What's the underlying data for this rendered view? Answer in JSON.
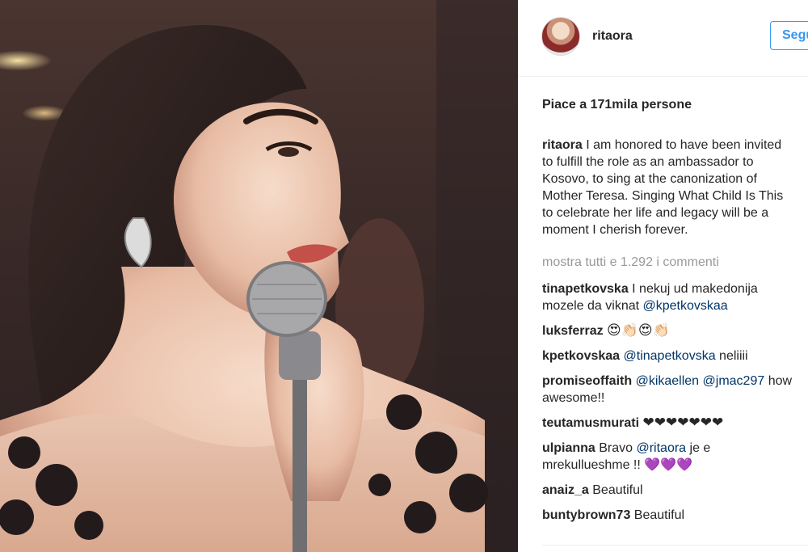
{
  "post": {
    "username": "ritaora",
    "follow_label": "Segui",
    "likes_text": "Piace a 171mila persone",
    "caption_user": "ritaora",
    "caption_text": " I am honored to have been invited\nto fulfill the role as an ambassador to\nKosovo, to sing at the canonization of\nMother Teresa. Singing What Child Is This\nto celebrate her life and legacy will be a\nmoment I cherish forever.",
    "show_all_comments": "mostra tutti e 1.292 i commenti"
  },
  "comments": [
    {
      "user": "tinapetkovska",
      "pre": " I nekuj ud makedonija\nmozele da viknat ",
      "mention": "@kpetkovskaa",
      "post": ""
    },
    {
      "user": "luksferraz",
      "pre": " ",
      "mention": "",
      "post": "😍👏🏻😍👏🏻"
    },
    {
      "user": "kpetkovskaa",
      "pre": " ",
      "mention": "@tinapetkovska",
      "post": " neliiii"
    },
    {
      "user": "promiseoffaith",
      "pre": " ",
      "mention": "@kikaellen @jmac297",
      "post": " how\nawesome!!"
    },
    {
      "user": "teutamusmurati",
      "pre": " ",
      "mention": "",
      "post": "❤❤❤❤❤❤❤"
    },
    {
      "user": "ulpianna",
      "pre": " Bravo ",
      "mention": "@ritaora",
      "post": " je e\nmrekullueshme !! 💜💜💜"
    },
    {
      "user": "anaiz_a",
      "pre": " Beautiful",
      "mention": "",
      "post": ""
    },
    {
      "user": "buntybrown73",
      "pre": " Beautiful",
      "mention": "",
      "post": ""
    }
  ],
  "colors": {
    "follow_blue": "#3897f0",
    "mention_blue": "#003569",
    "muted_gray": "#999999",
    "text": "#262626"
  },
  "icons": {
    "avatar": "profile-avatar"
  }
}
